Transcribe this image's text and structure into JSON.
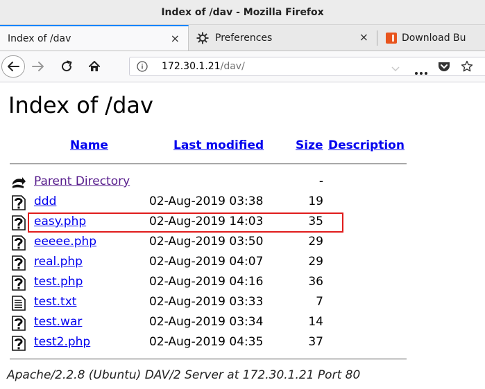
{
  "window": {
    "title": "Index of /dav - Mozilla Firefox"
  },
  "tabs": [
    {
      "label": "Index of /dav",
      "active": true,
      "close": "×"
    },
    {
      "label": "Preferences",
      "active": false,
      "close": "×",
      "icon": "gear-icon"
    },
    {
      "label": "Download Bu",
      "active": false,
      "icon": "download-bundle-icon"
    }
  ],
  "navbar": {
    "url_host": "172.30.1.21",
    "url_path": "/dav/",
    "icons": [
      "back-arrow-icon",
      "forward-arrow-icon",
      "reload-icon",
      "home-icon",
      "info-icon",
      "chevron-down-icon",
      "more-icon",
      "pocket-icon",
      "star-icon"
    ]
  },
  "page": {
    "title": "Index of /dav",
    "columns": {
      "name": "Name",
      "last_modified": "Last modified",
      "size": "Size",
      "description": "Description"
    },
    "rows": [
      {
        "name": "Parent Directory",
        "modified": "",
        "size": "-",
        "icon": "parent-directory-icon"
      },
      {
        "name": "ddd",
        "modified": "02-Aug-2019 03:38",
        "size": "19",
        "icon": "unknown-file-icon"
      },
      {
        "name": "easy.php",
        "modified": "02-Aug-2019 14:03",
        "size": "35",
        "icon": "unknown-file-icon"
      },
      {
        "name": "eeeee.php",
        "modified": "02-Aug-2019 03:50",
        "size": "29",
        "icon": "unknown-file-icon"
      },
      {
        "name": "real.php",
        "modified": "02-Aug-2019 04:07",
        "size": "29",
        "icon": "unknown-file-icon"
      },
      {
        "name": "test.php",
        "modified": "02-Aug-2019 04:16",
        "size": "36",
        "icon": "unknown-file-icon"
      },
      {
        "name": "test.txt",
        "modified": "02-Aug-2019 03:33",
        "size": "7",
        "icon": "text-file-icon"
      },
      {
        "name": "test.war",
        "modified": "02-Aug-2019 03:34",
        "size": "14",
        "icon": "unknown-file-icon"
      },
      {
        "name": "test2.php",
        "modified": "02-Aug-2019 04:35",
        "size": "37",
        "icon": "unknown-file-icon"
      }
    ],
    "address": "Apache/2.2.8 (Ubuntu) DAV/2 Server at 172.30.1.21 Port 80"
  },
  "colors": {
    "link": "#0000ee",
    "visited_link": "#551a8b",
    "highlight_box": "#e01b1b",
    "tab_accent": "#0a84ff"
  }
}
